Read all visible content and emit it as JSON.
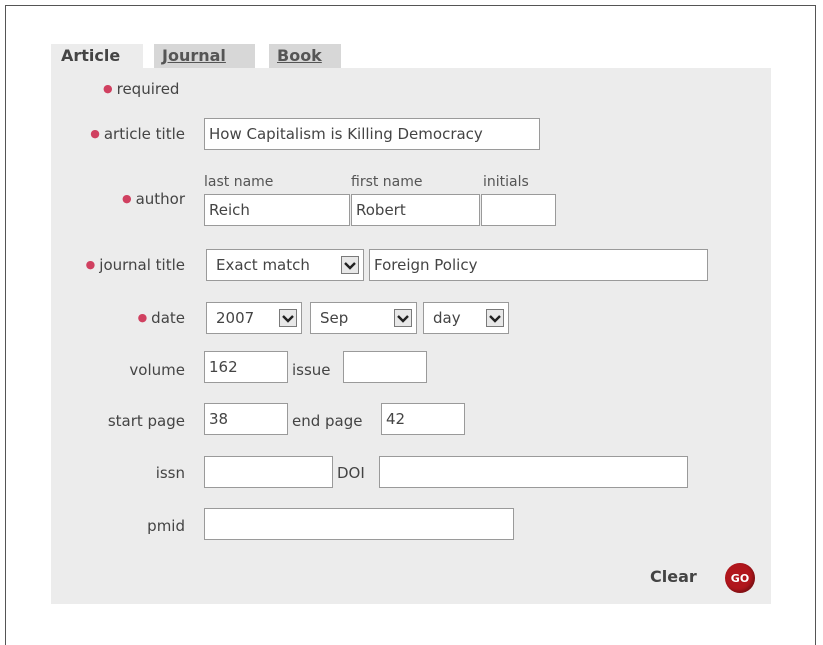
{
  "tabs": [
    {
      "label": "Article",
      "active": true
    },
    {
      "label": "Journal",
      "active": false
    },
    {
      "label": "Book",
      "active": false
    }
  ],
  "required_note": "required",
  "fields": {
    "article_title": {
      "label": "article title",
      "value": "How Capitalism is Killing Democracy"
    },
    "author": {
      "label": "author",
      "last_name_label": "last name",
      "last_name": "Reich",
      "first_name_label": "first name",
      "first_name": "Robert",
      "initials_label": "initials",
      "initials": ""
    },
    "journal_title": {
      "label": "journal title",
      "match_option": "Exact match",
      "value": "Foreign Policy"
    },
    "date": {
      "label": "date",
      "year": "2007",
      "month": "Sep",
      "day": "day"
    },
    "volume": {
      "label": "volume",
      "value": "162"
    },
    "issue": {
      "label": "issue",
      "value": ""
    },
    "start_page": {
      "label": "start page",
      "value": "38"
    },
    "end_page": {
      "label": "end page",
      "value": "42"
    },
    "issn": {
      "label": "issn",
      "value": ""
    },
    "doi": {
      "label": "DOI",
      "value": ""
    },
    "pmid": {
      "label": "pmid",
      "value": ""
    }
  },
  "actions": {
    "clear_label": "Clear",
    "go_label": "GO"
  },
  "colors": {
    "panel": "#ececec",
    "required_marker": "#d04060",
    "go_button": "#b1161c"
  }
}
